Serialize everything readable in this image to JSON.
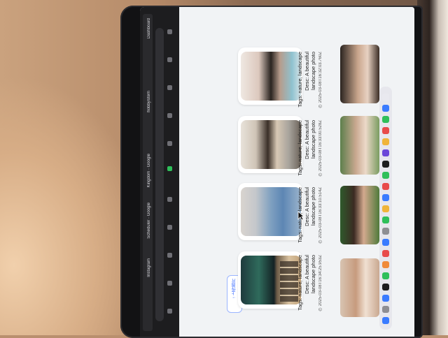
{
  "browser": {
    "tabs": [
      "Instagram",
      "Scheduler · Google",
      "Kingdom · Google",
      "hobbyistem",
      "Dashboard"
    ]
  },
  "gallery": {
    "upload_label": "↑ 上传图片",
    "cards": [
      {
        "tags": "Tags: nature, landscape",
        "desc1": "Desc: A beautiful",
        "desc2": "landscape photo",
        "date": "◷ 2025-03-08T16:34:25.953Z"
      },
      {
        "tags": "Tags: nature, landscape",
        "desc1": "Desc: A beautiful",
        "desc2": "landscape photo",
        "date": "◷ 2025-03-08T16:33:10.514Z"
      },
      {
        "tags": "Tags: nature, landscape",
        "desc1": "Desc: A beautiful",
        "desc2": "landscape photo",
        "date": "◷ 2025-03-08T16:33:00.528Z"
      },
      {
        "tags": "Tags: nature, landscape",
        "desc1": "Desc: A beautiful",
        "desc2": "landscape photo",
        "date": "◷ 2025-03-08T16:32:03.760Z"
      }
    ]
  },
  "colors": {
    "accent": "#3366ff",
    "card_bg": "#ffffff",
    "page_bg": "#f1f3f5"
  }
}
